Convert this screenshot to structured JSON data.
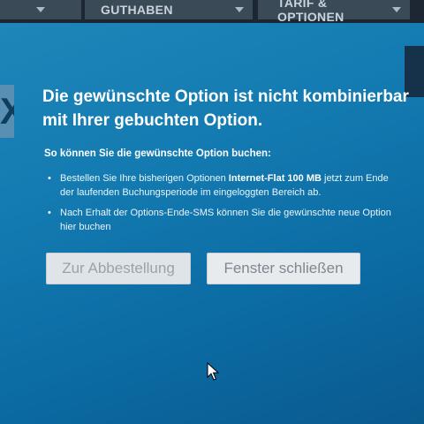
{
  "nav": {
    "tabs": [
      {
        "label": ""
      },
      {
        "label": "GUTHABEN"
      },
      {
        "label": "TARIF & OPTIONEN"
      }
    ]
  },
  "dialog": {
    "title": "Die gewünschte Option ist nicht kombinierbar mit Ihrer gebuchten Option.",
    "subtitle": "So können Sie die gewünschte Option buchen:",
    "bullet1_pre": "Bestellen Sie Ihre bisherigen Optionen ",
    "bullet1_bold": "Internet-Flat 100 MB",
    "bullet1_post": " jetzt zum Ende der laufenden Buchungsperiode im eingeloggten Bereich ab.",
    "bullet2": "Nach Erhalt der Options-Ende-SMS können Sie die gewünschte neue Option hier buchen",
    "button_cancel_order": "Zur Abbestellung",
    "button_close": "Fenster schließen",
    "left_edge_glyph": "X"
  },
  "colors": {
    "dialog_bg": "#137bb1",
    "button_bg": "#e8ebee",
    "nav_tab_bg": "#3b4a57"
  }
}
